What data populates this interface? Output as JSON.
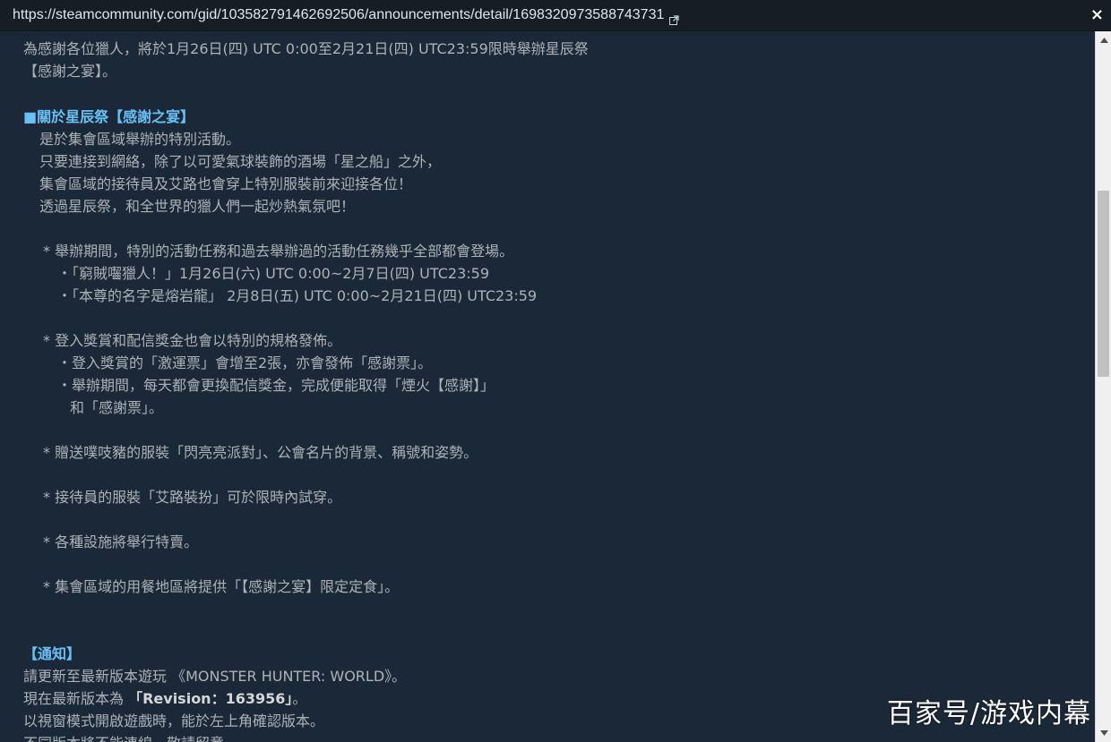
{
  "browser": {
    "url": "https://steamcommunity.com/gid/103582791462692506/announcements/detail/1698320973588743731",
    "close_label": "×"
  },
  "article": {
    "intro": [
      "為感謝各位獵人，將於1月26日(四) UTC 0:00至2月21日(四) UTC23:59限時舉辦星辰祭",
      "【感謝之宴】。"
    ],
    "section1": {
      "heading": "■關於星辰祭【感謝之宴】",
      "paragraph": [
        "是於集會區域舉辦的特別活動。",
        "只要連接到網絡，除了以可愛氣球裝飾的酒場「星之船」之外，",
        "集會區域的接待員及艾路也會穿上特別服裝前來迎接各位！",
        "透過星辰祭，和全世界的獵人們一起炒熱氣氛吧！"
      ],
      "bullet1": "* 舉辦期間，特別的活動任務和過去舉辦過的活動任務幾乎全部都會登場。",
      "bullet1_items": [
        "・「窮賊囓獵人！」1月26日(六) UTC 0:00~2月7日(四) UTC23:59",
        "・「本尊的名字是熔岩龍」 2月8日(五) UTC 0:00~2月21日(四) UTC23:59"
      ],
      "bullet2": "* 登入獎賞和配信獎金也會以特別的規格發佈。",
      "bullet2_items": [
        "・登入獎賞的「激運票」會增至2張，亦會發佈「感謝票」。",
        "・舉辦期間，每天都會更換配信獎金，完成便能取得「煙火【感謝】」",
        "和「感謝票」。"
      ],
      "bullet3": "* 贈送噗吱豬的服裝「閃亮亮派對」、公會名片的背景、稱號和姿勢。",
      "bullet4": "* 接待員的服裝「艾路裝扮」可於限時內試穿。",
      "bullet5": "* 各種設施將舉行特賣。",
      "bullet6": "* 集會區域的用餐地區將提供「【感謝之宴】限定定食」。"
    },
    "notice": {
      "heading": "【通知】",
      "line1": "請更新至最新版本遊玩 《MONSTER HUNTER: WORLD》。",
      "line2_prefix": "現在最新版本為 ",
      "line2_strong": "「Revision：163956」",
      "line2_suffix": "。",
      "line3": "以視窗模式開啟遊戲時，能於左上角確認版本。",
      "line4": "不同版本將不能連線，敬請留意。"
    }
  },
  "watermark": "百家号/游戏内幕",
  "colors": {
    "background": "#1b2838",
    "text": "#acb2b8",
    "heading": "#67c1f5",
    "urlbar": "#171d25"
  },
  "icons": {
    "external_link": "external-link-icon",
    "close": "close-icon",
    "scroll_up": "chevron-up-icon",
    "scroll_down": "chevron-down-icon"
  }
}
